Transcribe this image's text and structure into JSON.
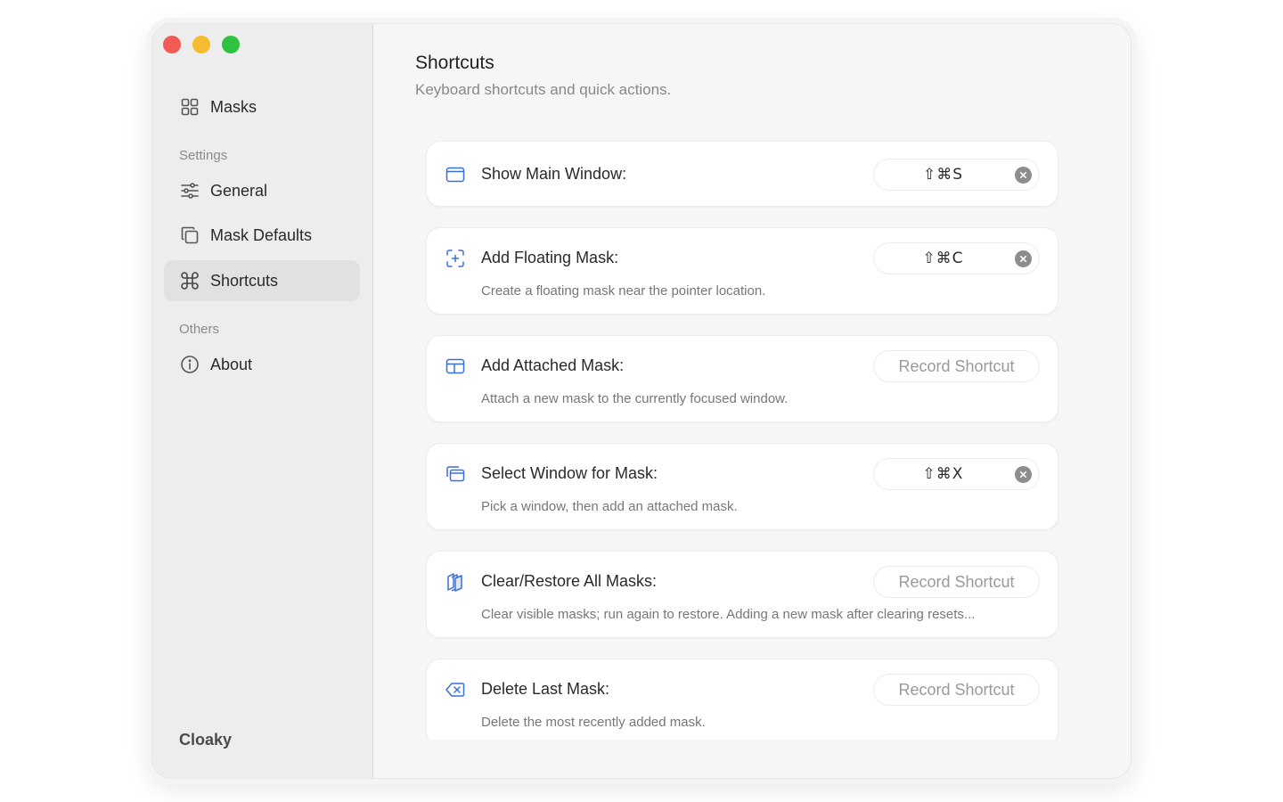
{
  "sidebar": {
    "items": [
      {
        "label": "Masks"
      },
      {
        "label": "General"
      },
      {
        "label": "Mask Defaults"
      },
      {
        "label": "Shortcuts"
      },
      {
        "label": "About"
      }
    ],
    "sections": {
      "settings": "Settings",
      "others": "Others"
    },
    "brand": "Cloaky"
  },
  "header": {
    "title": "Shortcuts",
    "subtitle": "Keyboard shortcuts and quick actions."
  },
  "shortcuts": [
    {
      "title": "Show Main Window:",
      "description": "",
      "shortcut": "⇧⌘S",
      "icon": "window-icon"
    },
    {
      "title": "Add Floating Mask:",
      "description": "Create a floating mask near the pointer location.",
      "shortcut": "⇧⌘C",
      "icon": "floating-mask-icon"
    },
    {
      "title": "Add Attached Mask:",
      "description": "Attach a new mask to the currently focused window.",
      "shortcut": "",
      "placeholder": "Record Shortcut",
      "icon": "attached-mask-icon"
    },
    {
      "title": "Select Window for Mask:",
      "description": "Pick a window, then add an attached mask.",
      "shortcut": "⇧⌘X",
      "icon": "select-window-icon"
    },
    {
      "title": "Clear/Restore All Masks:",
      "description": "Clear visible masks; run again to restore. Adding a new mask after clearing resets...",
      "shortcut": "",
      "placeholder": "Record Shortcut",
      "icon": "stack-icon"
    },
    {
      "title": "Delete Last Mask:",
      "description": "Delete the most recently added mask.",
      "shortcut": "",
      "placeholder": "Record Shortcut",
      "icon": "delete-icon"
    }
  ],
  "colors": {
    "accent": "#3b6fd8",
    "active_item": "#e1e1e1",
    "close": "#f25a55",
    "minimize": "#f5bc2f",
    "maximize": "#2fc140"
  }
}
